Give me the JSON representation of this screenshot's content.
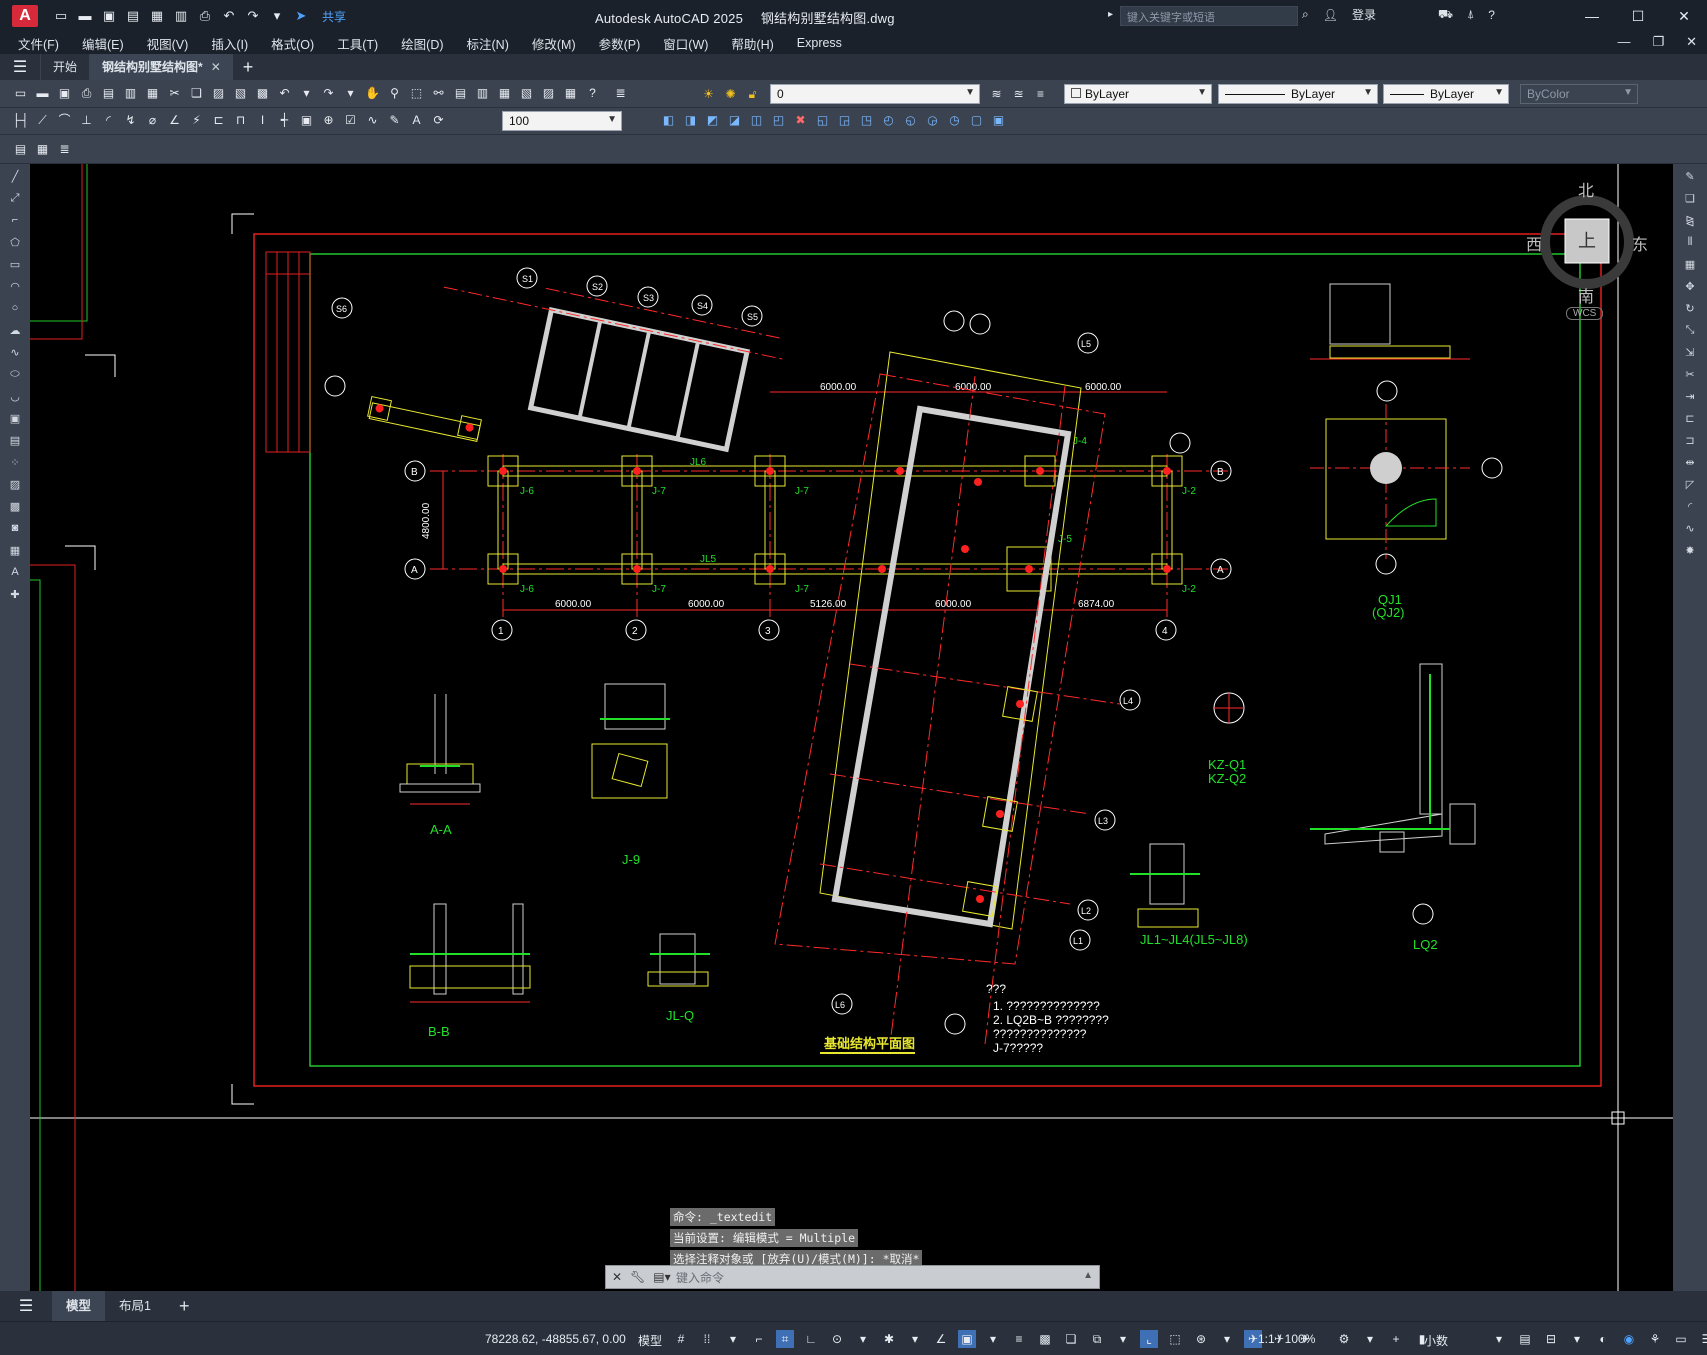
{
  "app": {
    "logo": "A",
    "window_title": "Autodesk AutoCAD 2025",
    "document_name": "钢结构别墅结构图.dwg",
    "share_label": "共享",
    "search_placeholder": "键入关键字或短语",
    "login_label": "登录"
  },
  "menu": {
    "items": [
      "文件(F)",
      "编辑(E)",
      "视图(V)",
      "插入(I)",
      "格式(O)",
      "工具(T)",
      "绘图(D)",
      "标注(N)",
      "修改(M)",
      "参数(P)",
      "窗口(W)",
      "帮助(H)",
      "Express"
    ]
  },
  "tabs": {
    "start": "开始",
    "drawing": "钢结构别墅结构图*"
  },
  "toolbar": {
    "layer_value": "0",
    "color_value": "ByLayer",
    "linetype_value": "ByLayer",
    "lineweight_value": "ByLayer",
    "plotstyle_value": "ByColor",
    "dim_scale": "100"
  },
  "viewcube": {
    "north": "北",
    "south": "南",
    "east": "东",
    "west": "西",
    "top": "上",
    "wcs": "WCS"
  },
  "drawing": {
    "title": "基础结构平面图",
    "grid_letters": [
      "A",
      "B"
    ],
    "grid_numbers": [
      "1",
      "2",
      "3",
      "4"
    ],
    "dims_bottom": [
      "6000.00",
      "6000.00",
      "5126.00",
      "6000.00",
      "6874.00"
    ],
    "dims_top": [
      "6000.00",
      "6000.00",
      "6000.00"
    ],
    "vertical_dim": "4800.00",
    "section_labels": [
      "A-A",
      "J-9",
      "B-B",
      "JL-Q",
      "JL1~JL4(JL5~JL8)",
      "KZ-Q1",
      "KZ-Q2",
      "QJ1",
      "(QJ2)",
      "LQ2"
    ],
    "axis_s": [
      "S1",
      "S2",
      "S3",
      "S4",
      "S5",
      "S6"
    ],
    "axis_l": [
      "L1",
      "L2",
      "L3",
      "L4",
      "L5",
      "L6"
    ],
    "notes": [
      "???",
      "1. ??????????????",
      "2. LQ2B~B  ????????",
      "   ??????????????",
      "   J-7?????"
    ]
  },
  "command": {
    "history": [
      "命令: _textedit",
      "当前设置: 编辑模式 = Multiple",
      "选择注释对象或 [放弃(U)/模式(M)]: *取消*"
    ],
    "placeholder": "键入命令"
  },
  "layout_tabs": {
    "model": "模型",
    "layout1": "布局1"
  },
  "status": {
    "coordinates": "78228.62, -48855.67, 0.00",
    "mode": "模型",
    "annotation_scale": "1:1 / 100%",
    "units": "小数"
  },
  "colors": {
    "accent": "#4ea3ff",
    "canvas": "#000000",
    "border_red": "#e02020",
    "frame_green": "#22c42a",
    "structure_yellow": "#e8e830",
    "dim_red": "#ff2a2a",
    "cyan_dim": "#2fd6d6"
  }
}
